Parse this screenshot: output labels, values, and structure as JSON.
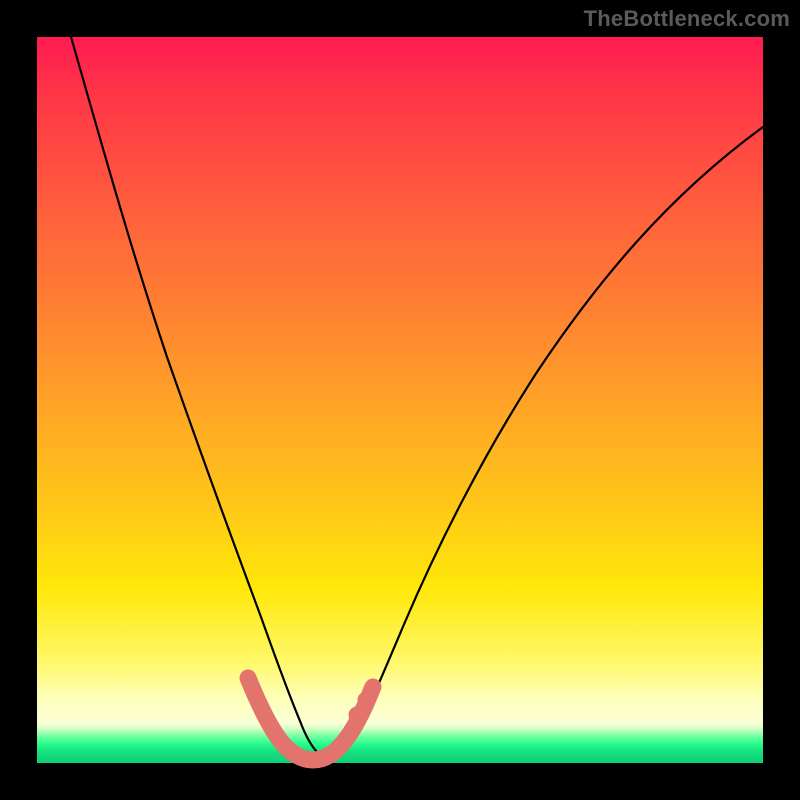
{
  "attribution": "TheBottleneck.com",
  "colors": {
    "background": "#000000",
    "curve": "#000000",
    "marker": "#e2736d",
    "gradient_top": "#ff1a52",
    "gradient_bottom": "#0fcf78"
  },
  "chart_data": {
    "type": "line",
    "title": "",
    "xlabel": "",
    "ylabel": "",
    "x": [
      0.0,
      0.02,
      0.04,
      0.06,
      0.08,
      0.1,
      0.12,
      0.14,
      0.16,
      0.18,
      0.2,
      0.22,
      0.24,
      0.26,
      0.28,
      0.3,
      0.32,
      0.33,
      0.34,
      0.35,
      0.36,
      0.37,
      0.38,
      0.39,
      0.4,
      0.42,
      0.44,
      0.46,
      0.48,
      0.5,
      0.55,
      0.6,
      0.65,
      0.7,
      0.75,
      0.8,
      0.85,
      0.9,
      0.95,
      1.0
    ],
    "series": [
      {
        "name": "bottleneck-curve",
        "values": [
          1.0,
          0.92,
          0.84,
          0.76,
          0.68,
          0.6,
          0.52,
          0.44,
          0.36,
          0.29,
          0.23,
          0.17,
          0.12,
          0.085,
          0.06,
          0.04,
          0.025,
          0.018,
          0.012,
          0.008,
          0.005,
          0.004,
          0.004,
          0.006,
          0.012,
          0.03,
          0.06,
          0.095,
          0.135,
          0.175,
          0.265,
          0.345,
          0.415,
          0.475,
          0.53,
          0.58,
          0.625,
          0.665,
          0.7,
          0.73
        ]
      }
    ],
    "xlim": [
      0,
      1
    ],
    "ylim": [
      0,
      1
    ],
    "markers": {
      "color": "#e2736d",
      "points_x": [
        0.288,
        0.3,
        0.313,
        0.327,
        0.342,
        0.358,
        0.374,
        0.389,
        0.403,
        0.415,
        0.426,
        0.437,
        0.447
      ],
      "points_y": [
        0.094,
        0.072,
        0.053,
        0.037,
        0.024,
        0.015,
        0.01,
        0.01,
        0.016,
        0.028,
        0.044,
        0.063,
        0.085
      ]
    }
  }
}
